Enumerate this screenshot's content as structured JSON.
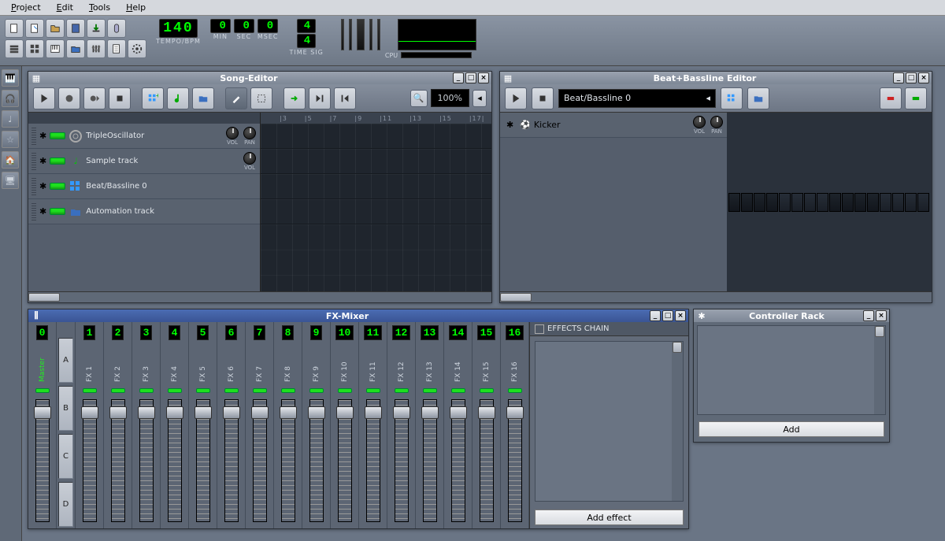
{
  "menu": {
    "project": "Project",
    "edit": "Edit",
    "tools": "Tools",
    "help": "Help"
  },
  "tempo": {
    "value": "140",
    "label": "TEMPO/BPM"
  },
  "time": {
    "min": "0",
    "min_lbl": "MIN",
    "sec": "0",
    "sec_lbl": "SEC",
    "msec": "0",
    "msec_lbl": "MSEC"
  },
  "timesig": {
    "num": "4",
    "den": "4",
    "label": "TIME SIG"
  },
  "cpu": {
    "label": "CPU"
  },
  "song": {
    "title": "Song-Editor",
    "zoom": "100%",
    "vol": "VOL",
    "pan": "PAN",
    "tracks": [
      {
        "name": "TripleOscillator",
        "type": "osc"
      },
      {
        "name": "Sample track",
        "type": "sample"
      },
      {
        "name": "Beat/Bassline 0",
        "type": "bb"
      },
      {
        "name": "Automation track",
        "type": "auto"
      }
    ],
    "ruler": [
      "|3",
      "|5",
      "|7",
      "|9",
      "|11",
      "|13",
      "|15",
      "|17|"
    ]
  },
  "bb": {
    "title": "Beat+Bassline Editor",
    "combo": "Beat/Bassline 0",
    "vol": "VOL",
    "pan": "PAN",
    "track": "Kicker",
    "steps": 16
  },
  "fx": {
    "title": "FX-Mixer",
    "chain": "EFFECTS CHAIN",
    "add": "Add effect",
    "master": "Master",
    "channels": [
      {
        "n": "1",
        "name": "FX 1"
      },
      {
        "n": "2",
        "name": "FX 2"
      },
      {
        "n": "3",
        "name": "FX 3"
      },
      {
        "n": "4",
        "name": "FX 4"
      },
      {
        "n": "5",
        "name": "FX 5"
      },
      {
        "n": "6",
        "name": "FX 6"
      },
      {
        "n": "7",
        "name": "FX 7"
      },
      {
        "n": "8",
        "name": "FX 8"
      },
      {
        "n": "9",
        "name": "FX 9"
      },
      {
        "n": "10",
        "name": "FX 10"
      },
      {
        "n": "11",
        "name": "FX 11"
      },
      {
        "n": "12",
        "name": "FX 12"
      },
      {
        "n": "13",
        "name": "FX 13"
      },
      {
        "n": "14",
        "name": "FX 14"
      },
      {
        "n": "15",
        "name": "FX 15"
      },
      {
        "n": "16",
        "name": "FX 16"
      }
    ],
    "sends": [
      "A",
      "B",
      "C",
      "D"
    ]
  },
  "rack": {
    "title": "Controller Rack",
    "add": "Add"
  }
}
